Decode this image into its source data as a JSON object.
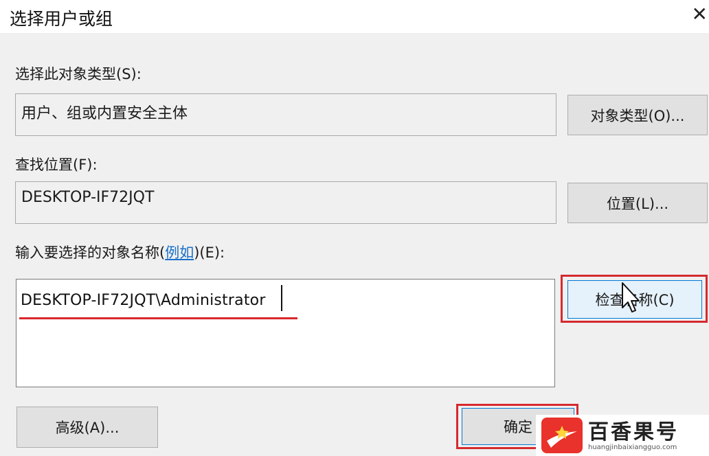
{
  "dialog": {
    "title": "选择用户或组",
    "close_glyph": "✕"
  },
  "object_type": {
    "label": "选择此对象类型(S):",
    "value": "用户、组或内置安全主体",
    "button": "对象类型(O)..."
  },
  "location": {
    "label": "查找位置(F):",
    "value": "DESKTOP-IF72JQT",
    "button": "位置(L)..."
  },
  "object_names": {
    "label_prefix": "输入要选择的对象名称(",
    "label_link": "例如",
    "label_suffix": ")(E):",
    "value": "DESKTOP-IF72JQT\\Administrator",
    "check_button": "检查名称(C)"
  },
  "footer": {
    "advanced_button": "高级(A)...",
    "ok_button": "确定"
  },
  "watermark": {
    "title": "百香果号",
    "url": "huangjinbaixiangguo.com"
  },
  "colors": {
    "highlight_red": "#d52a2e",
    "link_blue": "#1a6fc9"
  }
}
